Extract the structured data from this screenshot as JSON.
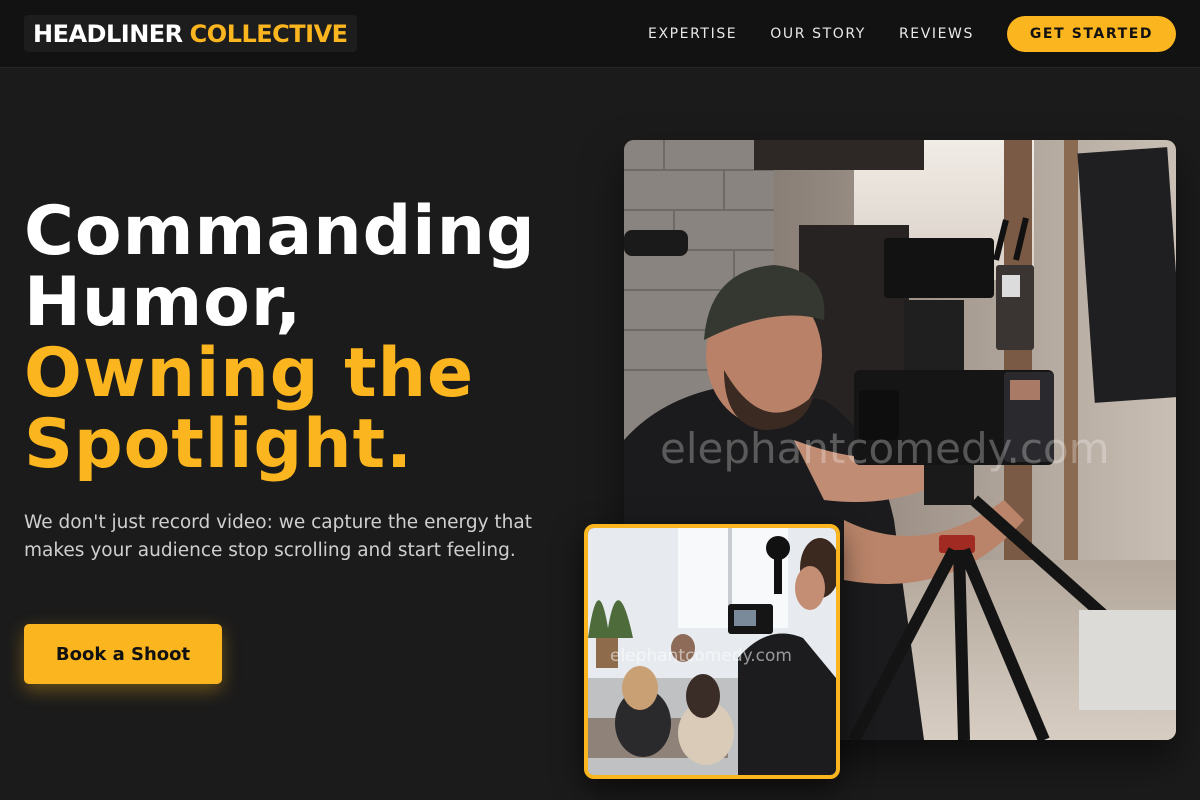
{
  "brand": {
    "part1": "HEADLINER",
    "part2": "COLLECTIVE"
  },
  "nav": {
    "links": [
      "EXPERTISE",
      "OUR STORY",
      "REVIEWS"
    ],
    "cta_label": "GET STARTED"
  },
  "hero": {
    "headline_lines": [
      "Commanding",
      "Humor,",
      "Owning the",
      "Spotlight."
    ],
    "subtext": "We don't just record video: we capture the energy that makes your audience stop scrolling and start feeling.",
    "button_label": "Book a Shoot"
  },
  "images": {
    "main_watermark": "elephantcomedy.com",
    "inset_watermark": "elephantcomedy.com",
    "main_subject": "cameraman-photo",
    "inset_subject": "film-crew-photo"
  },
  "colors": {
    "accent": "#fbb51e",
    "background": "#1b1b1b",
    "nav_background": "#121212"
  }
}
